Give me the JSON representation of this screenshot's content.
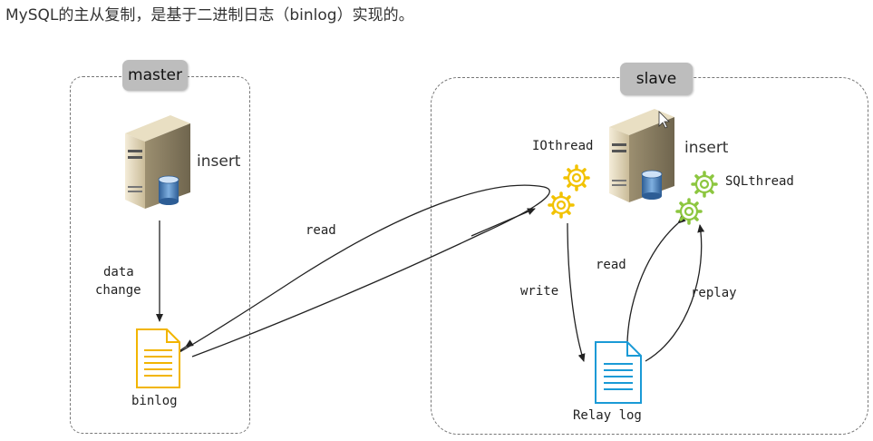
{
  "title": "MySQL的主从复制，是基于二进制日志（binlog）实现的。",
  "master": {
    "tag": "master",
    "insert_label": "insert",
    "data_change_line1": "data",
    "data_change_line2": "change",
    "binlog_label": "binlog"
  },
  "edges": {
    "read": "read",
    "write": "write",
    "read2": "read",
    "replay": "replay"
  },
  "slave": {
    "tag": "slave",
    "insert_label": "insert",
    "iothread_label": "IOthread",
    "sqlthread_label": "SQLthread",
    "relay_label": "Relay log"
  },
  "colors": {
    "binlog_doc": "#f2b500",
    "relay_doc": "#1a9ad6",
    "gear_yellow": "#f2c200",
    "gear_green": "#8cc63f"
  }
}
